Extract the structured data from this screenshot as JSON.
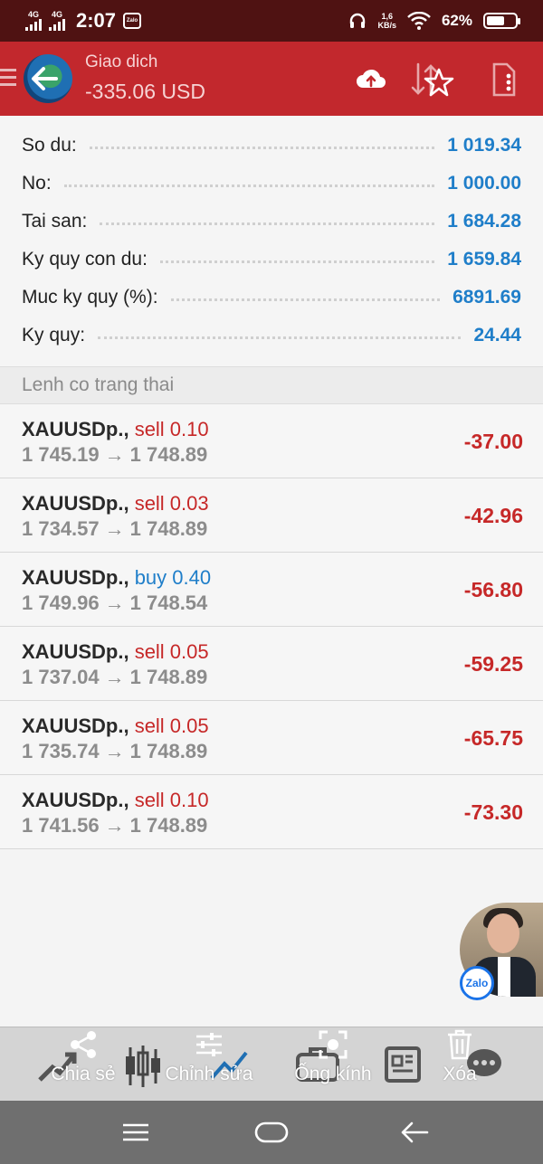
{
  "status_bar": {
    "network1": "4G",
    "network2": "4G",
    "time": "2:07",
    "zalo_label": "Zalo",
    "speed_value": "1,6",
    "speed_unit": "KB/s",
    "battery": "62%",
    "battery_fraction": 0.62
  },
  "header": {
    "subtitle": "Giao dich",
    "title": "-335.06 USD"
  },
  "summary": [
    {
      "label": "So du:",
      "value": "1 019.34"
    },
    {
      "label": "No:",
      "value": "1 000.00"
    },
    {
      "label": "Tai san:",
      "value": "1 684.28"
    },
    {
      "label": "Ky quy con du:",
      "value": "1 659.84"
    },
    {
      "label": "Muc ky quy (%):",
      "value": "6891.69"
    },
    {
      "label": "Ky quy:",
      "value": "24.44"
    }
  ],
  "section_title": "Lenh co trang thai",
  "positions": [
    {
      "symbol": "XAUUSDp.,",
      "type": "sell",
      "volume": "sell 0.10",
      "open": "1 745.19",
      "arrow": "→",
      "current": "1 748.89",
      "profit": "-37.00"
    },
    {
      "symbol": "XAUUSDp.,",
      "type": "sell",
      "volume": "sell 0.03",
      "open": "1 734.57",
      "arrow": "→",
      "current": "1 748.89",
      "profit": "-42.96"
    },
    {
      "symbol": "XAUUSDp.,",
      "type": "buy",
      "volume": "buy 0.40",
      "open": "1 749.96",
      "arrow": "→",
      "current": "1 748.54",
      "profit": "-56.80"
    },
    {
      "symbol": "XAUUSDp.,",
      "type": "sell",
      "volume": "sell 0.05",
      "open": "1 737.04",
      "arrow": "→",
      "current": "1 748.89",
      "profit": "-59.25"
    },
    {
      "symbol": "XAUUSDp.,",
      "type": "sell",
      "volume": "sell 0.05",
      "open": "1 735.74",
      "arrow": "→",
      "current": "1 748.89",
      "profit": "-65.75"
    },
    {
      "symbol": "XAUUSDp.,",
      "type": "sell",
      "volume": "sell 0.10",
      "open": "1 741.56",
      "arrow": "→",
      "current": "1 748.89",
      "profit": "-73.30"
    }
  ],
  "chat_bubble": {
    "badge": "Zalo"
  },
  "toolbar": {
    "share": "Chia sẻ",
    "edit": "Chỉnh sửa",
    "lens": "Ống kính",
    "delete": "Xóa"
  },
  "colors": {
    "header": "#c2282d",
    "status_bar": "#4f1212",
    "value_blue": "#1f7ec9",
    "loss_red": "#c62828"
  },
  "icons": [
    "menu-icon",
    "back-arrow-icon",
    "cloud-upload-icon",
    "sort-icon",
    "star-icon",
    "document-icon",
    "share-icon",
    "sliders-icon",
    "lens-icon",
    "trash-icon",
    "menu-nav-icon",
    "home-nav-icon",
    "back-nav-icon"
  ]
}
